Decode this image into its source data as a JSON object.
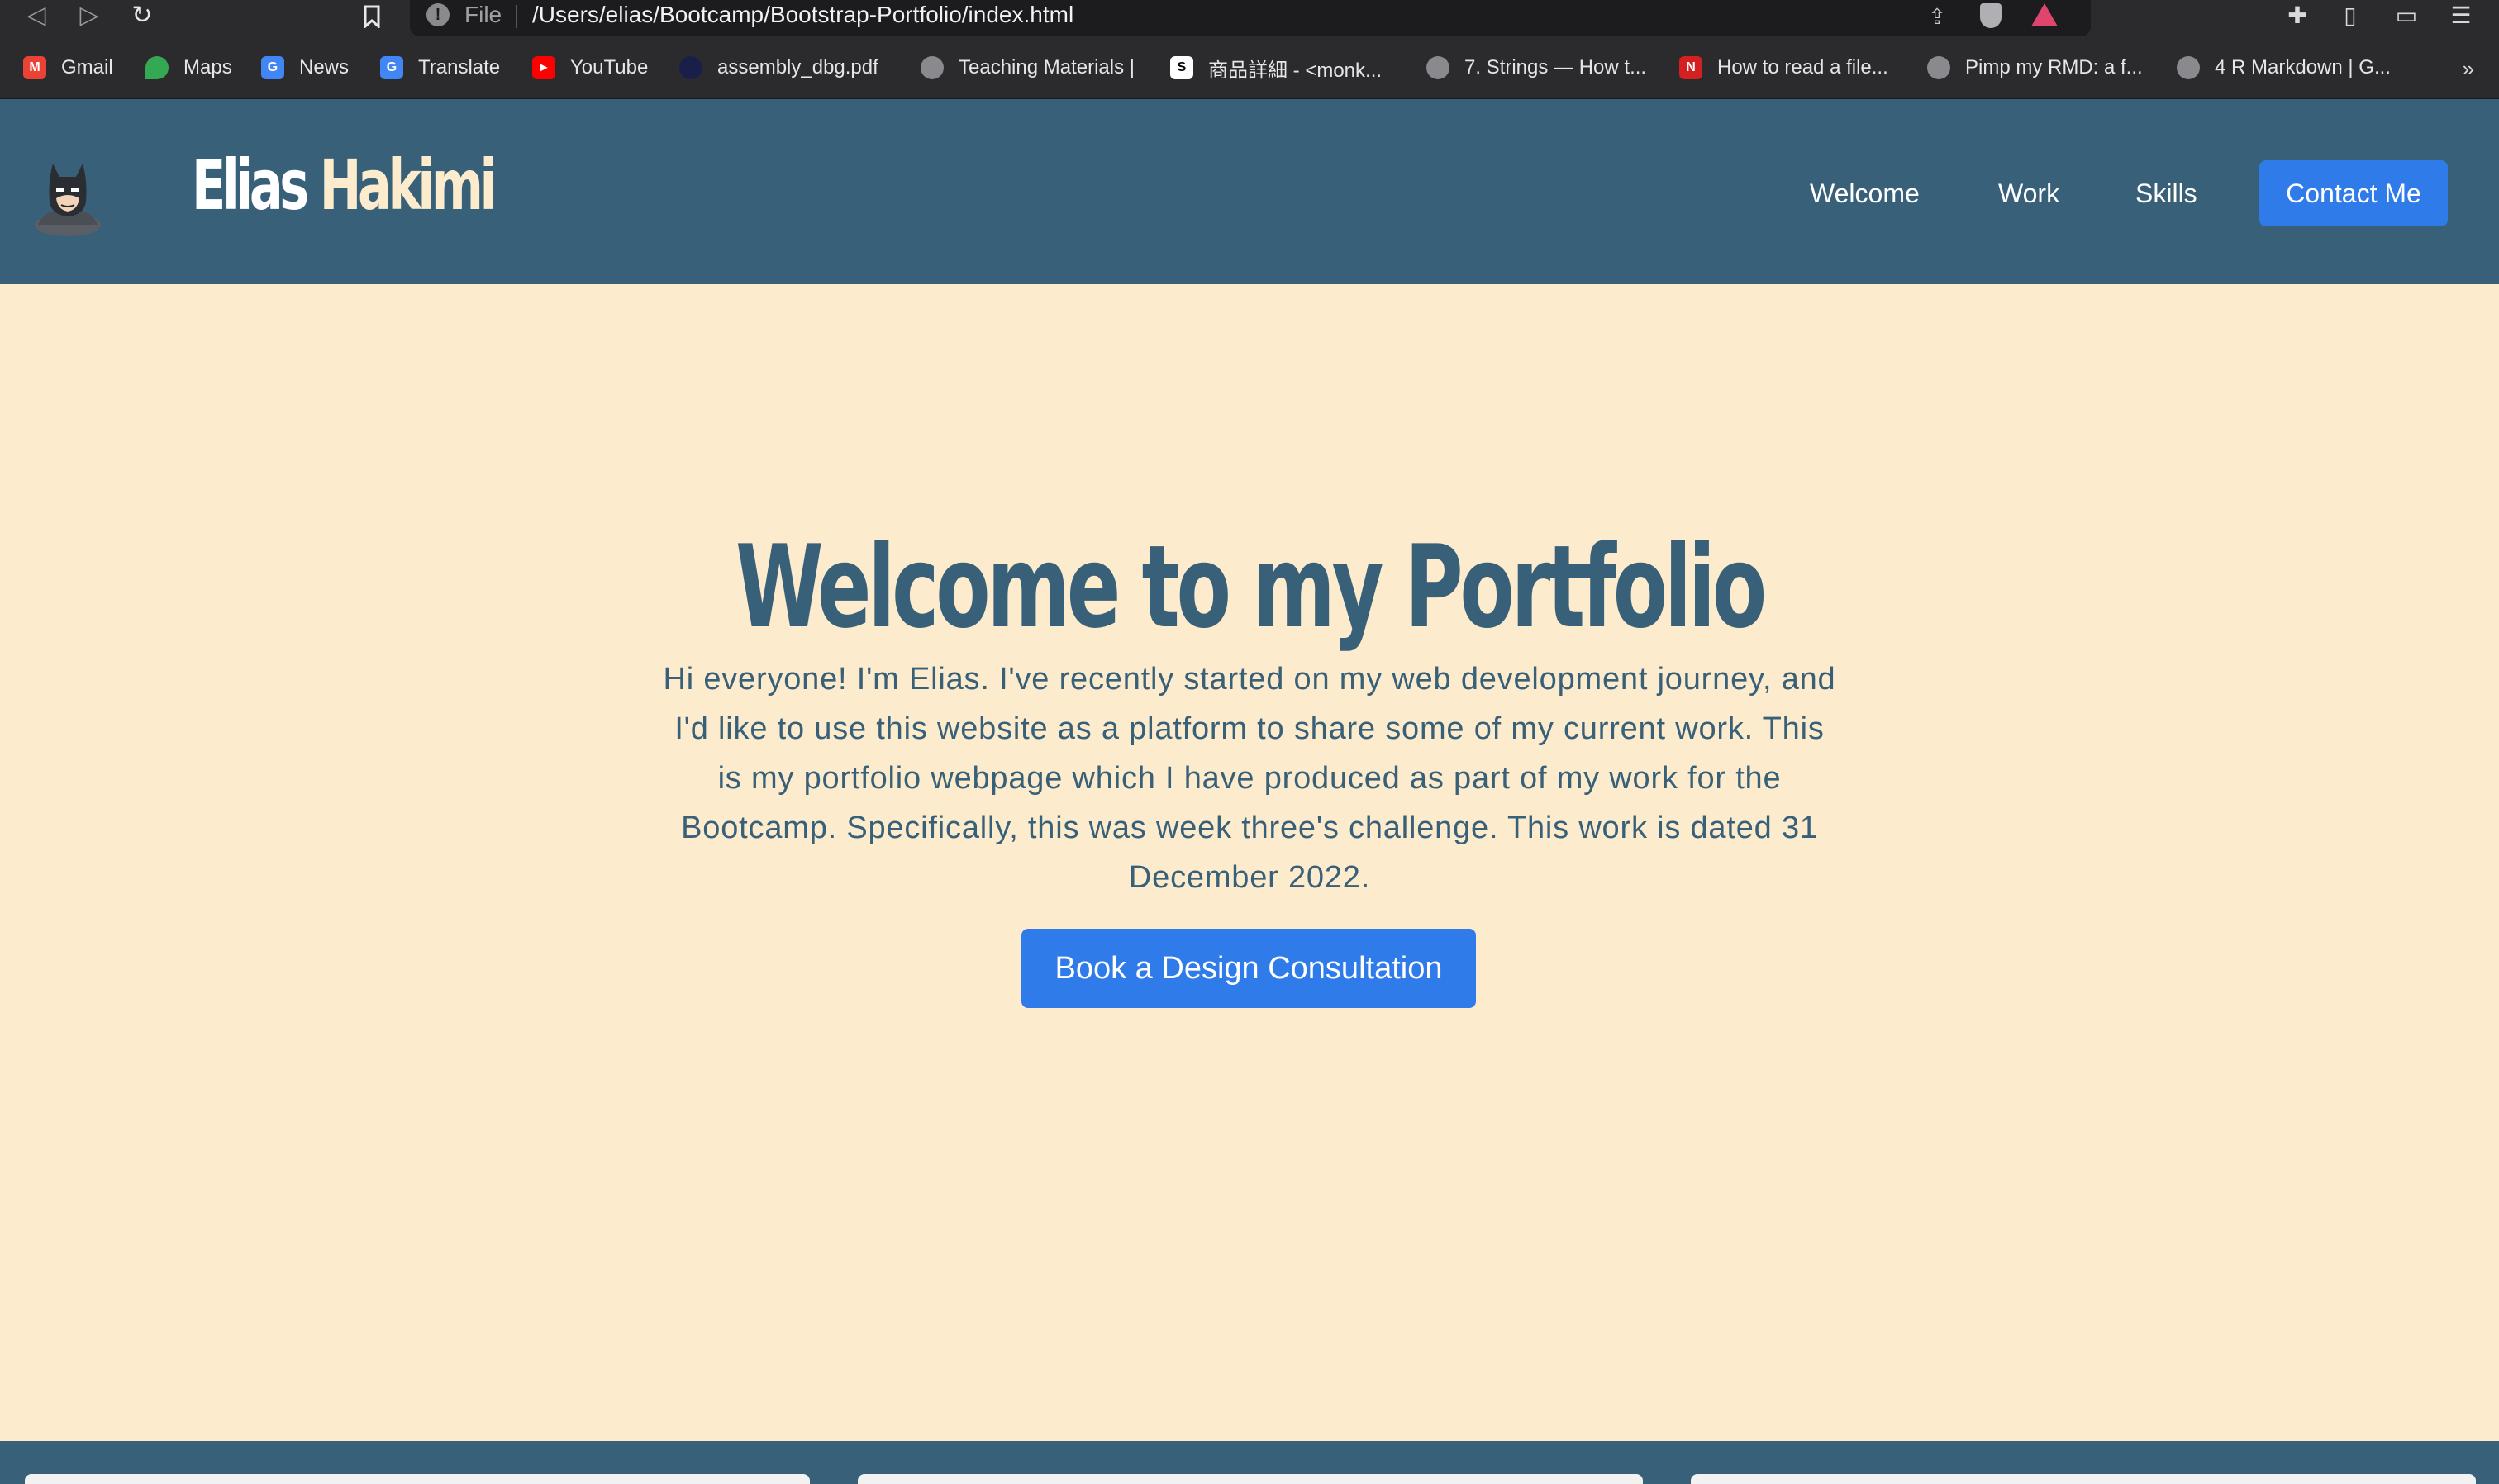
{
  "browser": {
    "url_scheme": "File",
    "url": "/Users/elias/Bootcamp/Bootstrap-Portfolio/index.html",
    "bookmarks": [
      {
        "label": "Gmail",
        "icon": "gmail-icon",
        "color": "#ea4335"
      },
      {
        "label": "Maps",
        "icon": "maps-pin-icon",
        "color": "#34a853"
      },
      {
        "label": "News",
        "icon": "google-news-icon",
        "color": "#4285f4"
      },
      {
        "label": "Translate",
        "icon": "google-translate-icon",
        "color": "#4285f4"
      },
      {
        "label": "YouTube",
        "icon": "youtube-icon",
        "color": "#ff0000"
      },
      {
        "label": "assembly_dbg.pdf",
        "icon": "pdf-globe-icon",
        "color": "#1a1f4a"
      },
      {
        "label": "Teaching Materials |",
        "icon": "globe-icon",
        "color": "#8a8a8e"
      },
      {
        "label": "商品詳細 - <monk...",
        "icon": "shop-icon",
        "color": "#ffffff"
      },
      {
        "label": "7. Strings — How t...",
        "icon": "globe-icon",
        "color": "#8a8a8e"
      },
      {
        "label": "How to read a file...",
        "icon": "n-logo-icon",
        "color": "#d32020"
      },
      {
        "label": "Pimp my RMD: a f...",
        "icon": "globe-icon",
        "color": "#8a8a8e"
      },
      {
        "label": "4 R Markdown | G...",
        "icon": "globe-icon",
        "color": "#8a8a8e"
      }
    ],
    "more_label": "»"
  },
  "header": {
    "brand_first": "Elias",
    "brand_last": "Hakimi",
    "nav": [
      "Welcome",
      "Work",
      "Skills"
    ],
    "contact_label": "Contact Me"
  },
  "hero": {
    "title": "Welcome to my Portfolio",
    "text": "Hi everyone! I'm Elias. I've recently started on my web development journey, and I'd like to use this website as a platform to share some of my current work. This is my portfolio webpage which I have produced as part of my work for the Bootcamp. Specifically, this was week three's challenge. This work is dated 31 December 2022.",
    "cta_label": "Book a Design Consultation"
  },
  "colors": {
    "primary": "#386078",
    "cream": "#fcebcd",
    "accent": "#2f7bea"
  }
}
